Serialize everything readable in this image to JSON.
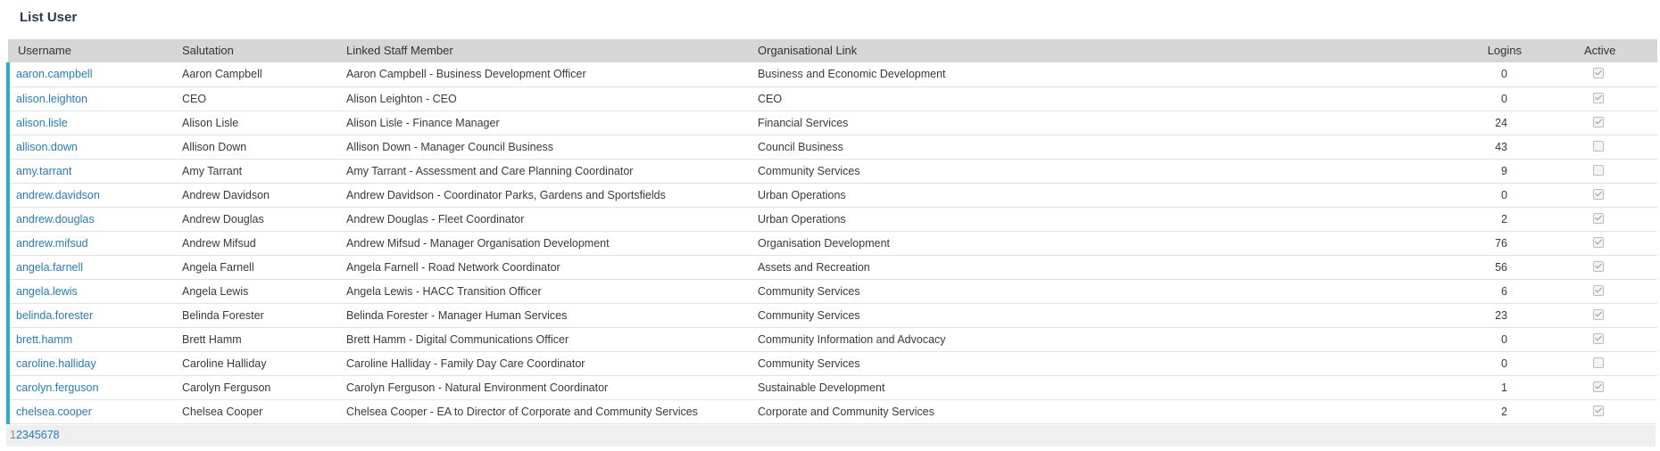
{
  "page": {
    "title": "List User"
  },
  "table": {
    "headers": {
      "username": "Username",
      "salutation": "Salutation",
      "linked_staff": "Linked Staff Member",
      "org_link": "Organisational Link",
      "logins": "Logins",
      "active": "Active"
    },
    "rows": [
      {
        "username": "aaron.campbell",
        "salutation": "Aaron Campbell",
        "linked_staff": "Aaron Campbell - Business Development Officer",
        "org_link": "Business and Economic Development",
        "logins": "0",
        "active": true
      },
      {
        "username": "alison.leighton",
        "salutation": "CEO",
        "linked_staff": "Alison Leighton - CEO",
        "org_link": "CEO",
        "logins": "0",
        "active": true
      },
      {
        "username": "alison.lisle",
        "salutation": "Alison Lisle",
        "linked_staff": "Alison Lisle - Finance Manager",
        "org_link": "Financial Services",
        "logins": "24",
        "active": true
      },
      {
        "username": "allison.down",
        "salutation": "Allison Down",
        "linked_staff": "Allison Down - Manager Council Business",
        "org_link": "Council Business",
        "logins": "43",
        "active": false
      },
      {
        "username": "amy.tarrant",
        "salutation": "Amy Tarrant",
        "linked_staff": "Amy Tarrant - Assessment and Care Planning Coordinator",
        "org_link": "Community Services",
        "logins": "9",
        "active": false
      },
      {
        "username": "andrew.davidson",
        "salutation": "Andrew Davidson",
        "linked_staff": "Andrew Davidson - Coordinator Parks, Gardens and Sportsfields",
        "org_link": "Urban Operations",
        "logins": "0",
        "active": true
      },
      {
        "username": "andrew.douglas",
        "salutation": "Andrew Douglas",
        "linked_staff": "Andrew Douglas - Fleet Coordinator",
        "org_link": "Urban Operations",
        "logins": "2",
        "active": true
      },
      {
        "username": "andrew.mifsud",
        "salutation": "Andrew Mifsud",
        "linked_staff": "Andrew Mifsud - Manager Organisation Development",
        "org_link": "Organisation Development",
        "logins": "76",
        "active": true
      },
      {
        "username": "angela.farnell",
        "salutation": "Angela Farnell",
        "linked_staff": "Angela Farnell - Road Network Coordinator",
        "org_link": "Assets and Recreation",
        "logins": "56",
        "active": true
      },
      {
        "username": "angela.lewis",
        "salutation": "Angela Lewis",
        "linked_staff": "Angela Lewis - HACC Transition Officer",
        "org_link": "Community Services",
        "logins": "6",
        "active": true
      },
      {
        "username": "belinda.forester",
        "salutation": "Belinda Forester",
        "linked_staff": "Belinda Forester - Manager Human Services",
        "org_link": "Community Services",
        "logins": "23",
        "active": true
      },
      {
        "username": "brett.hamm",
        "salutation": "Brett Hamm",
        "linked_staff": "Brett Hamm - Digital Communications Officer",
        "org_link": "Community Information and Advocacy",
        "logins": "0",
        "active": true
      },
      {
        "username": "caroline.halliday",
        "salutation": "Caroline Halliday",
        "linked_staff": "Caroline Halliday - Family Day Care Coordinator",
        "org_link": "Community Services",
        "logins": "0",
        "active": false
      },
      {
        "username": "carolyn.ferguson",
        "salutation": "Carolyn Ferguson",
        "linked_staff": "Carolyn Ferguson - Natural Environment Coordinator",
        "org_link": "Sustainable Development",
        "logins": "1",
        "active": true
      },
      {
        "username": "chelsea.cooper",
        "salutation": "Chelsea Cooper",
        "linked_staff": "Chelsea Cooper - EA to Director of Corporate and Community Services",
        "org_link": "Corporate and Community Services",
        "logins": "2",
        "active": true
      }
    ]
  },
  "pagination": {
    "pages": [
      "1",
      "2",
      "3",
      "4",
      "5",
      "6",
      "7",
      "8"
    ],
    "current": "1"
  },
  "colors": {
    "accent": "#2ab0c8",
    "link": "#2a7bb5",
    "header_bg": "#d6d6d6"
  }
}
